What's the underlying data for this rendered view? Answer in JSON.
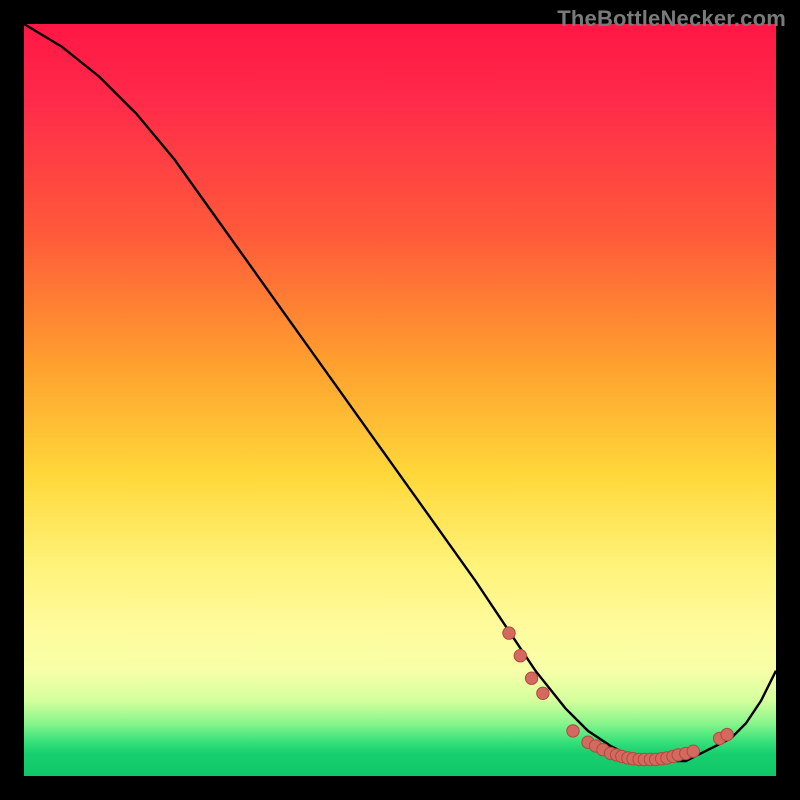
{
  "watermark": "TheBottleNecker.com",
  "colors": {
    "curve": "#000000",
    "dot_fill": "#d46a5f",
    "dot_stroke": "#b2493f",
    "frame_bg": "#000000"
  },
  "chart_data": {
    "type": "line",
    "title": "",
    "xlabel": "",
    "ylabel": "",
    "xlim": [
      0,
      100
    ],
    "ylim": [
      0,
      100
    ],
    "series": [
      {
        "name": "bottleneck-curve",
        "x": [
          0,
          5,
          10,
          15,
          20,
          25,
          30,
          35,
          40,
          45,
          50,
          55,
          60,
          64,
          68,
          72,
          75,
          78,
          80,
          82,
          84,
          86,
          88,
          90,
          92,
          94,
          96,
          98,
          100
        ],
        "y": [
          100,
          97,
          93,
          88,
          82,
          75,
          68,
          61,
          54,
          47,
          40,
          33,
          26,
          20,
          14,
          9,
          6,
          4,
          3,
          2,
          2,
          2,
          2,
          3,
          4,
          5,
          7,
          10,
          14
        ]
      }
    ],
    "points": [
      {
        "x": 64.5,
        "y": 19
      },
      {
        "x": 66.0,
        "y": 16
      },
      {
        "x": 67.5,
        "y": 13
      },
      {
        "x": 69.0,
        "y": 11
      },
      {
        "x": 73.0,
        "y": 6
      },
      {
        "x": 75.0,
        "y": 4.5
      },
      {
        "x": 76.0,
        "y": 4
      },
      {
        "x": 77.0,
        "y": 3.5
      },
      {
        "x": 78.0,
        "y": 3
      },
      {
        "x": 78.8,
        "y": 2.8
      },
      {
        "x": 79.5,
        "y": 2.6
      },
      {
        "x": 80.3,
        "y": 2.4
      },
      {
        "x": 81.0,
        "y": 2.3
      },
      {
        "x": 81.8,
        "y": 2.2
      },
      {
        "x": 82.5,
        "y": 2.2
      },
      {
        "x": 83.3,
        "y": 2.2
      },
      {
        "x": 84.0,
        "y": 2.2
      },
      {
        "x": 84.8,
        "y": 2.3
      },
      {
        "x": 85.5,
        "y": 2.4
      },
      {
        "x": 86.3,
        "y": 2.6
      },
      {
        "x": 87.0,
        "y": 2.8
      },
      {
        "x": 88.0,
        "y": 3.0
      },
      {
        "x": 89.0,
        "y": 3.3
      },
      {
        "x": 92.5,
        "y": 5.0
      },
      {
        "x": 93.5,
        "y": 5.5
      }
    ]
  }
}
